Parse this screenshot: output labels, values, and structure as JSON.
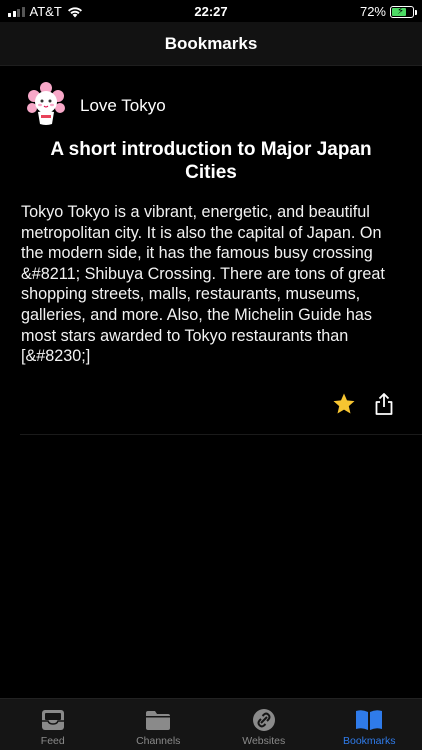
{
  "status_bar": {
    "carrier": "AT&T",
    "time": "22:27",
    "battery_percent": "72%",
    "battery_level": 0.72
  },
  "nav": {
    "title": "Bookmarks"
  },
  "article": {
    "source_name": "Love Tokyo",
    "title": "A short introduction to Major Japan Cities",
    "excerpt": "Tokyo Tokyo is a vibrant, energetic, and beautiful metropolitan city. It is also the capital of Japan. On the modern side, it has the famous busy crossing &#8211; Shibuya Crossing. There are tons of great shopping streets, malls, restaurants, museums, galleries, and more. Also, the Michelin Guide has most stars awarded to Tokyo restaurants than [&#8230;]",
    "bookmarked": true
  },
  "tabs": [
    {
      "label": "Feed",
      "icon": "inbox-icon",
      "active": false
    },
    {
      "label": "Channels",
      "icon": "folder-icon",
      "active": false
    },
    {
      "label": "Websites",
      "icon": "link-icon",
      "active": false
    },
    {
      "label": "Bookmarks",
      "icon": "book-icon",
      "active": true
    }
  ],
  "colors": {
    "accent": "#2f7bea",
    "star": "#f7c531",
    "battery": "#4cd964"
  }
}
